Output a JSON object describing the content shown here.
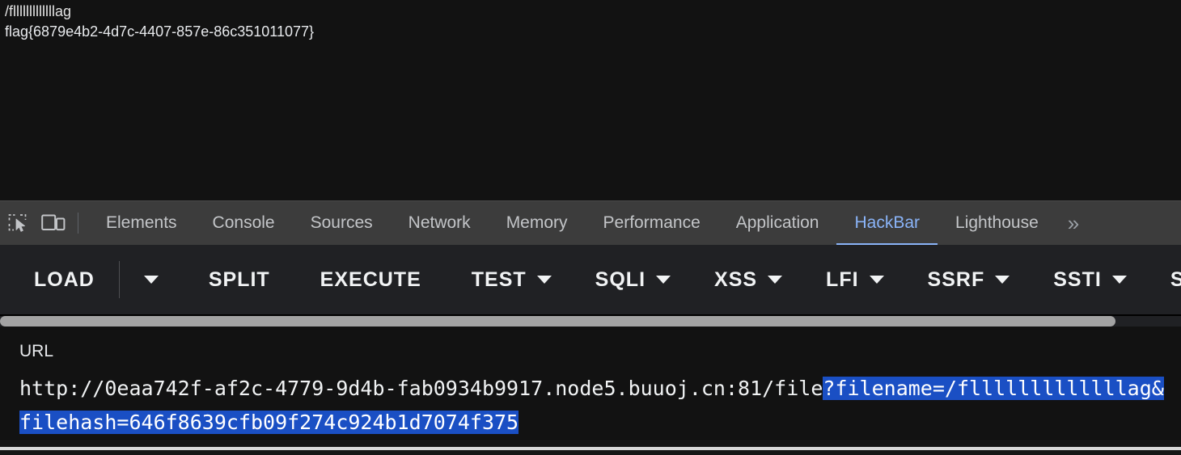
{
  "page_output": {
    "line1": "/flllllllllllllag",
    "line2": "flag{6879e4b2-4d7c-4407-857e-86c351011077}"
  },
  "devtools": {
    "icons": {
      "inspect": "inspect-element-icon",
      "device": "device-toolbar-icon"
    },
    "tabs": [
      {
        "label": "Elements",
        "active": false
      },
      {
        "label": "Console",
        "active": false
      },
      {
        "label": "Sources",
        "active": false
      },
      {
        "label": "Network",
        "active": false
      },
      {
        "label": "Memory",
        "active": false
      },
      {
        "label": "Performance",
        "active": false
      },
      {
        "label": "Application",
        "active": false
      },
      {
        "label": "HackBar",
        "active": true
      },
      {
        "label": "Lighthouse",
        "active": false
      }
    ],
    "overflow_label": "»",
    "active_tab": "HackBar",
    "accent_color": "#8ab4f8"
  },
  "hackbar_toolbar": {
    "load": "LOAD",
    "load_dropdown": "caret-down-icon",
    "split": "SPLIT",
    "execute": "EXECUTE",
    "test": "TEST",
    "sqli": "SQLI",
    "xss": "XSS",
    "lfi": "LFI",
    "ssrf": "SSRF",
    "ssti": "SSTI",
    "clipped": "S"
  },
  "url_panel": {
    "label": "URL",
    "value_plain": "http://0eaa742f-af2c-4779-9d4b-fab0934b9917.node5.buuoj.cn:81/file",
    "value_selected": "?filename=/flllllllllllllag&filehash=646f8639cfb09f274c924b1d7074f375",
    "full_value": "http://0eaa742f-af2c-4779-9d4b-fab0934b9917.node5.buuoj.cn:81/file?filename=/flllllllllllllag&filehash=646f8639cfb09f274c924b1d7074f375",
    "selection_color": "#1a4fc4"
  },
  "scrollbar": {
    "orientation": "horizontal",
    "thumb_color": "#a3a3a3"
  }
}
